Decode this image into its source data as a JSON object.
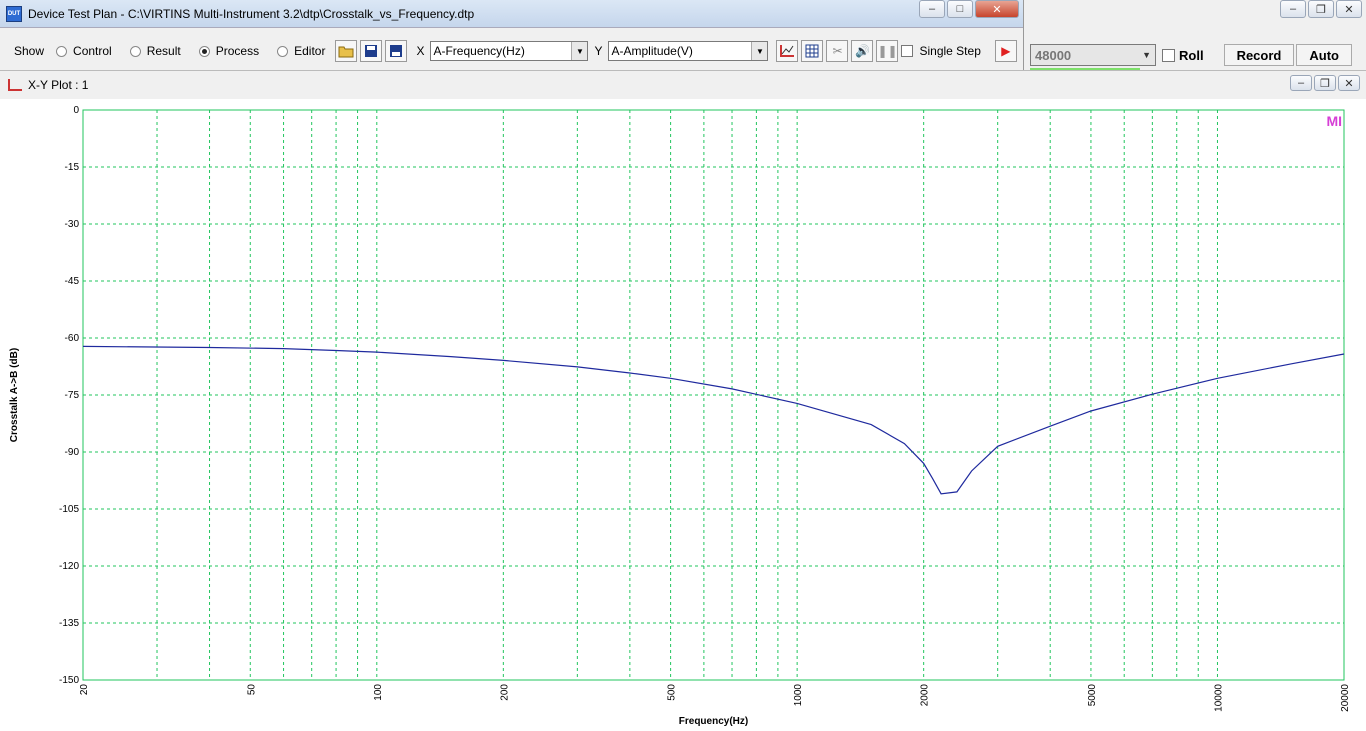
{
  "window": {
    "title": "Device Test Plan - C:\\VIRTINS Multi-Instrument 3.2\\dtp\\Crosstalk_vs_Frequency.dtp",
    "icon_text": "DUT"
  },
  "toolbar": {
    "show_label": "Show",
    "radios": [
      {
        "label": "Control",
        "checked": false
      },
      {
        "label": "Result",
        "checked": false
      },
      {
        "label": "Process",
        "checked": true
      },
      {
        "label": "Editor",
        "checked": false
      }
    ],
    "x_label": "X",
    "x_select": "A-Frequency(Hz)",
    "y_label": "Y",
    "y_select": "A-Amplitude(V)",
    "single_step_label": "Single Step",
    "icons": [
      "open-folder-icon",
      "save-icon",
      "save-as-icon",
      "xy-plot-icon",
      "table-icon",
      "tool-icon",
      "speaker-icon",
      "pause-icon",
      "run-icon"
    ]
  },
  "background_app": {
    "sample_rate": "48000",
    "roll_label": "Roll",
    "record_label": "Record",
    "auto_label": "Auto"
  },
  "plot_window": {
    "title": "X-Y Plot : 1",
    "watermark": "MI"
  },
  "colors": {
    "grid": "#22c55e",
    "curve": "#1f2a9e",
    "watermark": "#d63fd6"
  },
  "chart_data": {
    "type": "line",
    "xlabel": "Frequency(Hz)",
    "ylabel": "Crosstalk A->B (dB)",
    "xscale": "log",
    "xlim": [
      20,
      20000
    ],
    "ylim": [
      -150,
      0
    ],
    "xticks": [
      20,
      50,
      100,
      200,
      500,
      1000,
      2000,
      5000,
      10000,
      20000
    ],
    "xtick_labels": [
      "20",
      "50",
      "100",
      "200",
      "500",
      "1000",
      "2000",
      "5000",
      "10000",
      "20000"
    ],
    "yticks": [
      0,
      -15,
      -30,
      -45,
      -60,
      -75,
      -90,
      -105,
      -120,
      -135,
      -150
    ],
    "ytick_labels": [
      "0",
      "-15",
      "-30",
      "-45",
      "-60",
      "-75",
      "-90",
      "-105",
      "-120",
      "-135",
      "-150"
    ],
    "grid": true,
    "series": [
      {
        "x": [
          20,
          40,
          60,
          80,
          100,
          150,
          200,
          300,
          400,
          500,
          700,
          1000,
          1500,
          1800,
          2000,
          2100,
          2200,
          2400,
          2600,
          3000,
          4000,
          5000,
          7000,
          10000,
          15000,
          20000
        ],
        "y": [
          -62.2,
          -62.5,
          -62.8,
          -63.3,
          -63.7,
          -64.9,
          -65.9,
          -67.6,
          -69.2,
          -70.6,
          -73.4,
          -77.2,
          -82.8,
          -87.8,
          -93,
          -97,
          -101,
          -100.5,
          -95,
          -88.5,
          -83.2,
          -79.2,
          -74.8,
          -70.6,
          -66.8,
          -64.2
        ]
      }
    ]
  }
}
